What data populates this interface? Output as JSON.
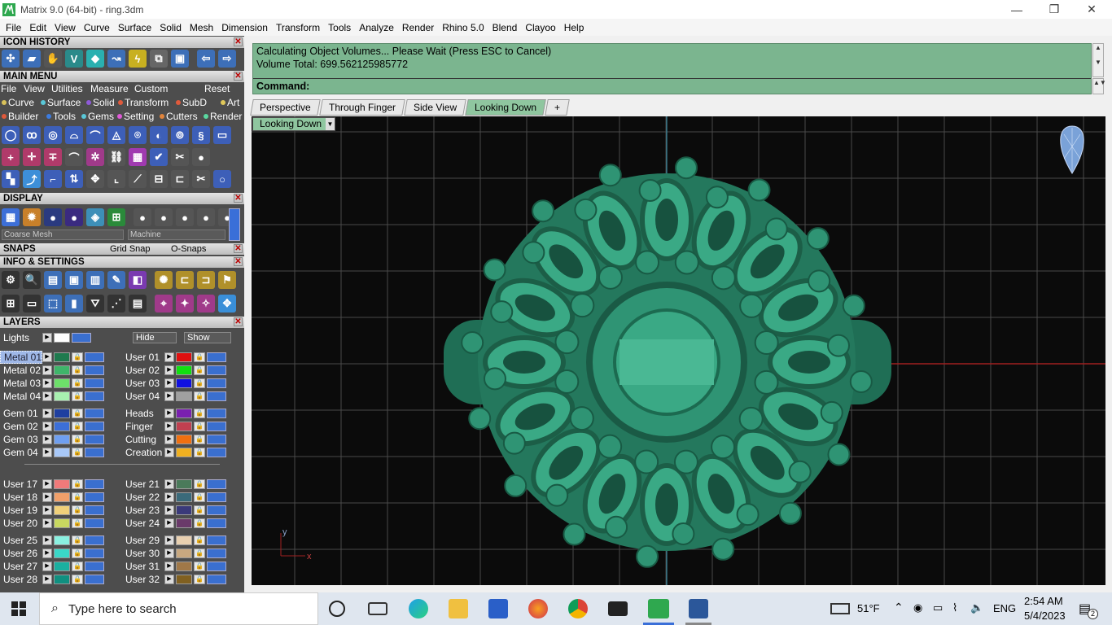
{
  "window": {
    "title": "Matrix 9.0 (64-bit) - ring.3dm",
    "minimize": "—",
    "restore": "❐",
    "close": "✕"
  },
  "menu": [
    "File",
    "Edit",
    "View",
    "Curve",
    "Surface",
    "Solid",
    "Mesh",
    "Dimension",
    "Transform",
    "Tools",
    "Analyze",
    "Render",
    "Rhino 5.0",
    "Blend",
    "Clayoo",
    "Help"
  ],
  "panel": {
    "icon_history": "ICON HISTORY",
    "main_menu": "MAIN MENU",
    "main_menu_items": [
      "File",
      "View",
      "Utilities",
      "Measure",
      "Custom"
    ],
    "reset": "Reset",
    "categories_row1": [
      {
        "label": "Curve",
        "color": "#d8c15a"
      },
      {
        "label": "Surface",
        "color": "#5ac8d8"
      },
      {
        "label": "Solid",
        "color": "#8e5ad8"
      },
      {
        "label": "Transform",
        "color": "#e05a3c"
      },
      {
        "label": "SubD",
        "color": "#e05a3c"
      },
      {
        "label": "Art",
        "color": "#e0c85a"
      }
    ],
    "categories_row2": [
      {
        "label": "Builder",
        "color": "#e05a3c"
      },
      {
        "label": "Tools",
        "color": "#3c7ce0"
      },
      {
        "label": "Gems",
        "color": "#5ac8d8"
      },
      {
        "label": "Setting",
        "color": "#e05ad8"
      },
      {
        "label": "Cutters",
        "color": "#e0843c"
      },
      {
        "label": "Render",
        "color": "#5ad8a0"
      }
    ],
    "display": "DISPLAY",
    "mesh_quality": "Coarse Mesh",
    "render_mode": "Machine",
    "snaps": "SNAPS",
    "grid_snap": "Grid Snap",
    "osnaps": "O-Snaps",
    "info_settings": "INFO & SETTINGS",
    "layers": "LAYERS",
    "lights": "Lights",
    "hide": "Hide",
    "show": "Show"
  },
  "layers_left": [
    {
      "name": "Metal 01",
      "color": "#1e7a4e",
      "selected": true
    },
    {
      "name": "Metal 02",
      "color": "#3fb56a"
    },
    {
      "name": "Metal 03",
      "color": "#6de06a"
    },
    {
      "name": "Metal 04",
      "color": "#a8f0b0"
    },
    {
      "name": "Gem 01",
      "color": "#1f3fa0"
    },
    {
      "name": "Gem 02",
      "color": "#3c6fd8"
    },
    {
      "name": "Gem 03",
      "color": "#6f9ff0"
    },
    {
      "name": "Gem 04",
      "color": "#a8c8f8"
    },
    {
      "name": "User 17",
      "color": "#f07a7a"
    },
    {
      "name": "User 18",
      "color": "#f0a06a"
    },
    {
      "name": "User 19",
      "color": "#f0d07a"
    },
    {
      "name": "User 20",
      "color": "#c8d860"
    },
    {
      "name": "User 25",
      "color": "#8af0e0"
    },
    {
      "name": "User 26",
      "color": "#3ad8c8"
    },
    {
      "name": "User 27",
      "color": "#1ab0a0"
    },
    {
      "name": "User 28",
      "color": "#109080"
    }
  ],
  "layers_right": [
    {
      "name": "User 01",
      "color": "#e01010"
    },
    {
      "name": "User 02",
      "color": "#10e010"
    },
    {
      "name": "User 03",
      "color": "#1010e0"
    },
    {
      "name": "User 04",
      "color": "#a0a0a0"
    },
    {
      "name": "Heads",
      "color": "#7a20b0"
    },
    {
      "name": "Finger",
      "color": "#c04050"
    },
    {
      "name": "Cutting",
      "color": "#f07010"
    },
    {
      "name": "Creation",
      "color": "#f0b020"
    },
    {
      "name": "User 21",
      "color": "#4a7a5a"
    },
    {
      "name": "User 22",
      "color": "#3a6a7a"
    },
    {
      "name": "User 23",
      "color": "#3a3a7a"
    },
    {
      "name": "User 24",
      "color": "#6a3a6a"
    },
    {
      "name": "User 29",
      "color": "#e8d0b0"
    },
    {
      "name": "User 30",
      "color": "#c8a880"
    },
    {
      "name": "User 31",
      "color": "#a07848"
    },
    {
      "name": "User 32",
      "color": "#806020"
    }
  ],
  "command": {
    "line1": "Calculating Object Volumes... Please Wait (Press ESC to Cancel)",
    "line2": "Volume Total: 699.562125985772",
    "prompt": "Command:"
  },
  "tabs": [
    "Perspective",
    "Through Finger",
    "Side View",
    "Looking Down"
  ],
  "active_tab": "Looking Down",
  "add_tab": "+",
  "viewport": {
    "label": "Looking Down",
    "axis_y": "y",
    "axis_x": "x"
  },
  "taskbar": {
    "search_placeholder": "Type here to search",
    "weather": "51°F",
    "lang": "ENG",
    "time": "2:54 AM",
    "date": "5/4/2023",
    "notifications": "2"
  }
}
